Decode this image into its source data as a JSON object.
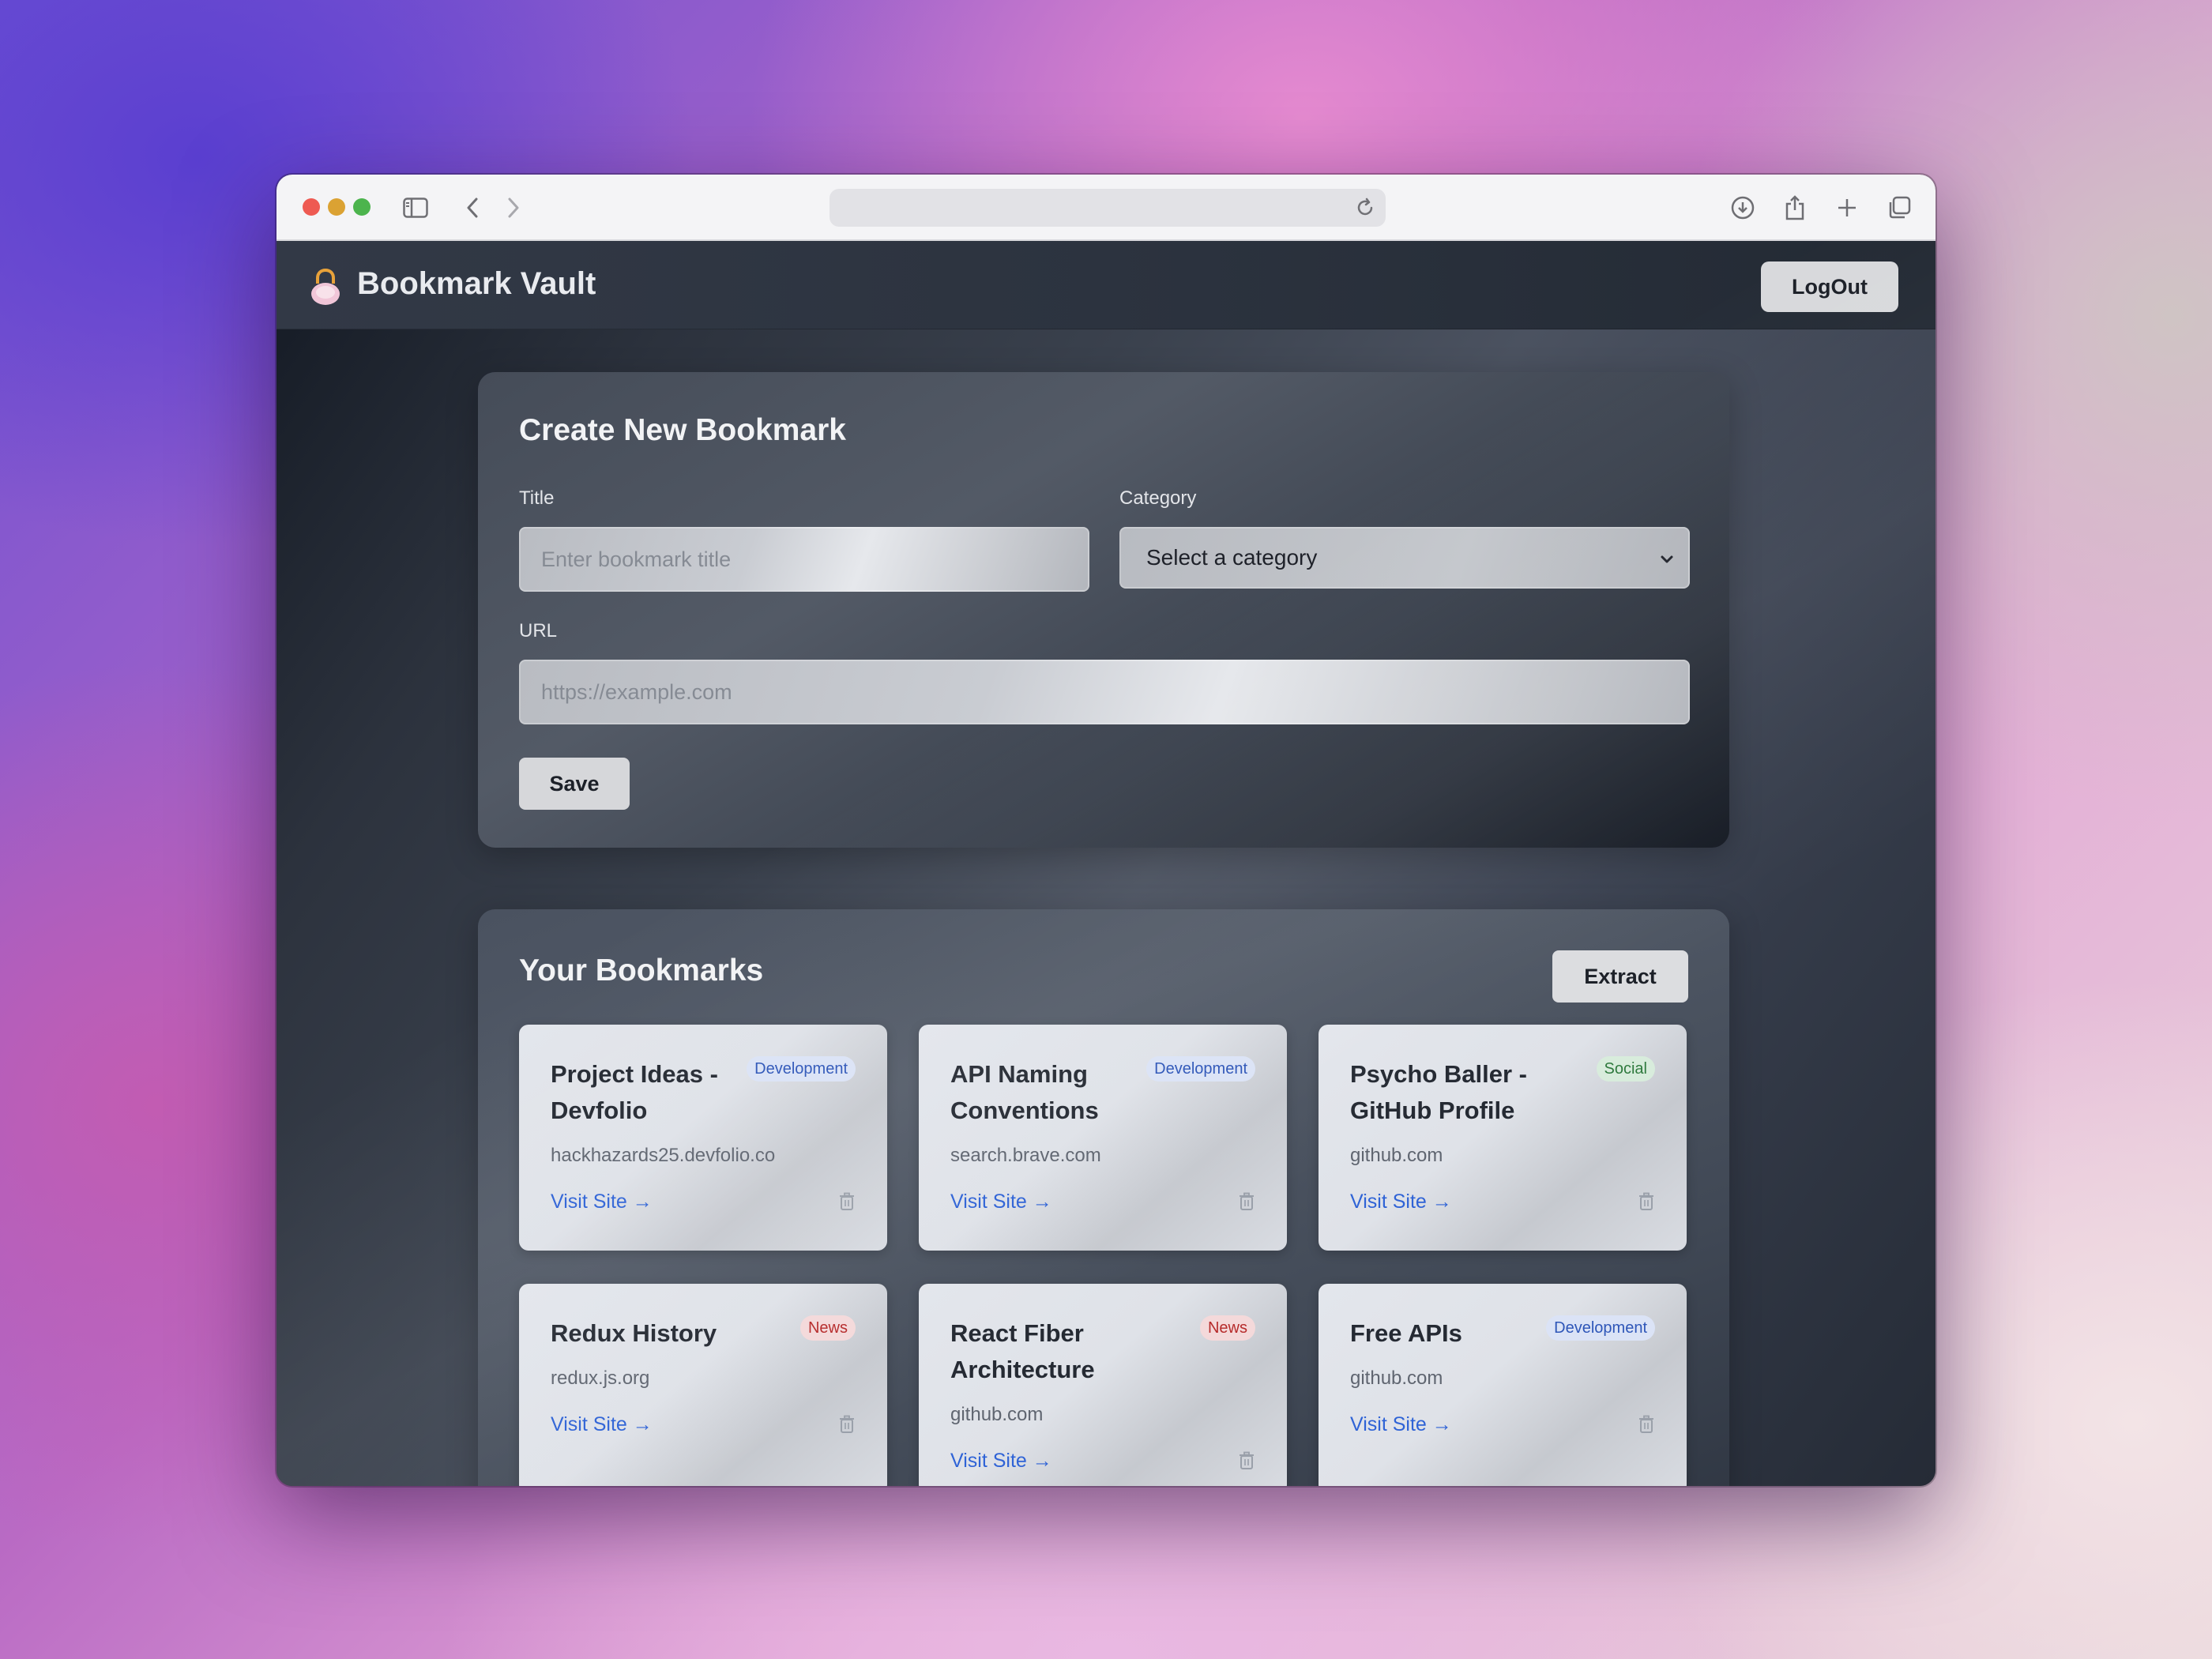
{
  "app": {
    "name": "Bookmark Vault",
    "logout_label": "LogOut"
  },
  "create": {
    "heading": "Create New Bookmark",
    "title_label": "Title",
    "title_placeholder": "Enter bookmark title",
    "category_label": "Category",
    "category_selected": "Select a category",
    "url_label": "URL",
    "url_placeholder": "https://example.com",
    "save_label": "Save"
  },
  "list": {
    "heading": "Your Bookmarks",
    "extract_label": "Extract",
    "visit_label": "Visit Site →",
    "bookmarks": [
      {
        "title": "Project Ideas - Devfolio",
        "category": "Development",
        "domain": "hackhazards25.devfolio.co"
      },
      {
        "title": "API Naming Conventions",
        "category": "Development",
        "domain": "search.brave.com"
      },
      {
        "title": "Psycho Baller - GitHub Profile",
        "category": "Social",
        "domain": "github.com"
      },
      {
        "title": "Redux History",
        "category": "News",
        "domain": "redux.js.org"
      },
      {
        "title": "React Fiber Architecture",
        "category": "News",
        "domain": "github.com"
      },
      {
        "title": "Free APIs",
        "category": "Development",
        "domain": "github.com"
      }
    ]
  },
  "colors": {
    "accent_link": "#2f63d6",
    "badge_development": "#2e56b8",
    "badge_news": "#b62b2b",
    "badge_social": "#2f7a3e"
  },
  "icons": {
    "browser": [
      "sidebar-icon",
      "back-icon",
      "forward-icon",
      "shield-icon",
      "reload-icon",
      "download-icon",
      "share-icon",
      "new-tab-icon",
      "tabs-icon"
    ],
    "card": "trash-icon",
    "logo": "lock-icon"
  }
}
